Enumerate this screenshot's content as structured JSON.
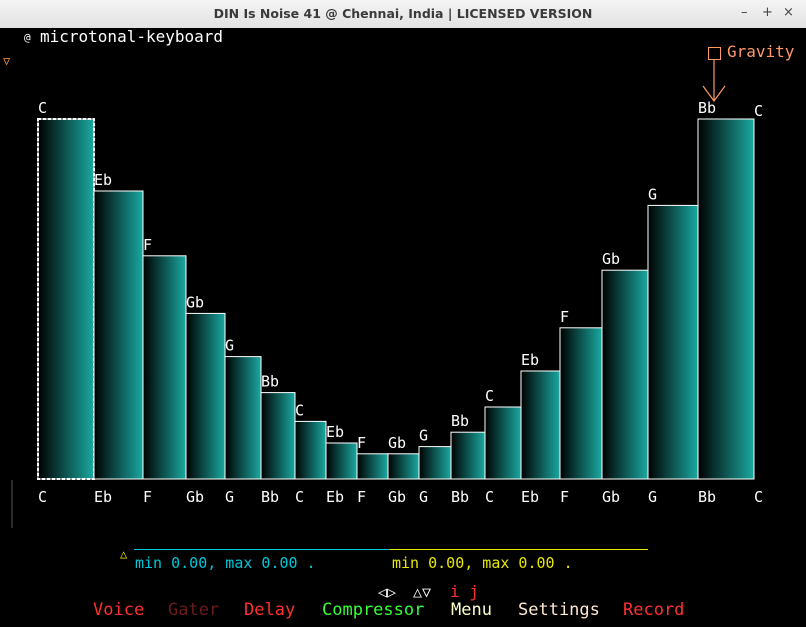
{
  "window": {
    "title": "DIN Is Noise 41 @ Chennai, India | LICENSED VERSION",
    "minimize": "–",
    "maximize": "+",
    "close": "×"
  },
  "instrument": {
    "marker": "@",
    "name": "microtonal-keyboard"
  },
  "gravity": {
    "label": "Gravity"
  },
  "keyboard": {
    "colors": {
      "bar_dark": "#000000",
      "bar_light": "#1aa9a1",
      "outline": "#ffffff",
      "selection": "#ffffff"
    },
    "keys": [
      {
        "top": "C",
        "bottom": "C",
        "level": 1.0,
        "selected": true
      },
      {
        "top": "Eb",
        "bottom": "Eb",
        "level": 0.8
      },
      {
        "top": "F",
        "bottom": "F",
        "level": 0.62
      },
      {
        "top": "Gb",
        "bottom": "Gb",
        "level": 0.46
      },
      {
        "top": "G",
        "bottom": "G",
        "level": 0.34
      },
      {
        "top": "Bb",
        "bottom": "Bb",
        "level": 0.24
      },
      {
        "top": "C",
        "bottom": "C",
        "level": 0.16
      },
      {
        "top": "Eb",
        "bottom": "Eb",
        "level": 0.1
      },
      {
        "top": "F",
        "bottom": "F",
        "level": 0.07
      },
      {
        "top": "Gb",
        "bottom": "Gb",
        "level": 0.07
      },
      {
        "top": "G",
        "bottom": "G",
        "level": 0.09
      },
      {
        "top": "Bb",
        "bottom": "Bb",
        "level": 0.13
      },
      {
        "top": "C",
        "bottom": "C",
        "level": 0.2
      },
      {
        "top": "Eb",
        "bottom": "Eb",
        "level": 0.3
      },
      {
        "top": "F",
        "bottom": "F",
        "level": 0.42
      },
      {
        "top": "Gb",
        "bottom": "Gb",
        "level": 0.58
      },
      {
        "top": "G",
        "bottom": "G",
        "level": 0.76
      },
      {
        "top": "Bb",
        "bottom": "Bb",
        "level": 1.0
      },
      {
        "top": "C",
        "bottom": "C",
        "level": null
      }
    ]
  },
  "ranges": {
    "left": {
      "text": "min 0.00, max 0.00 .",
      "color": "#00c8d8"
    },
    "right": {
      "text": "min 0.00, max 0.00 .",
      "color": "#e8e800"
    }
  },
  "nav": {
    "arrows_lr": "◁▷",
    "arrows_ud": "△▽",
    "keys": "i j"
  },
  "menu": [
    {
      "label": "Voice",
      "color": "#ff3030"
    },
    {
      "label": "Gater",
      "color": "#6b1b1b"
    },
    {
      "label": "Delay",
      "color": "#ff3030"
    },
    {
      "label": "Compressor",
      "color": "#33ff33"
    },
    {
      "label": "Menu",
      "color": "#ffffcc"
    },
    {
      "label": "Settings",
      "color": "#ffe8d0"
    },
    {
      "label": "Record",
      "color": "#ff3030"
    }
  ]
}
